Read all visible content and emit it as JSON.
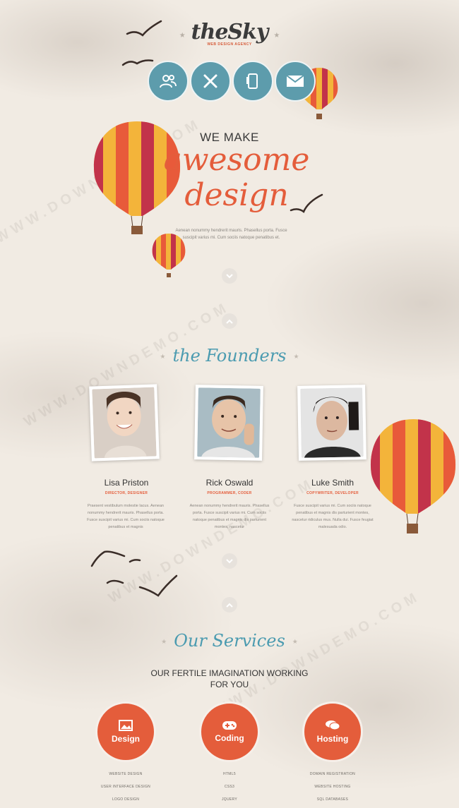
{
  "header": {
    "logo": "theSky",
    "tagline": "WEB DESIGN AGENCY",
    "nav": [
      {
        "icon": "users-icon"
      },
      {
        "icon": "tools-icon"
      },
      {
        "icon": "phone-icon"
      },
      {
        "icon": "mail-icon"
      }
    ]
  },
  "hero": {
    "kicker": "WE MAKE",
    "headline_line1": "awesome",
    "headline_line2": "design",
    "text": "Aenean nonummy hendrerit mauris. Phasellus porta. Fusce suscipit varius mi. Cum sociis natoque penatibus et."
  },
  "founders": {
    "title": "the Founders",
    "people": [
      {
        "name": "Lisa Priston",
        "role": "DIRECTOR, DESIGNER",
        "bio": "Praesent vestibulum molestie lacus. Aenean nonummy hendrerit mauris. Phasellus porta. Fusce suscipit varius mi. Cum sociis natoque penatibus et magnis"
      },
      {
        "name": "Rick Oswald",
        "role": "PROGRAMMER, CODER",
        "bio": "Aenean nonummy hendrerit mauris. Phasellus porta. Fusce suscipit varius mi. Cum sociis natoque penatibus et magnis dis parturient montes, nascetur"
      },
      {
        "name": "Luke Smith",
        "role": "COPYWRITER, DEVELOPER",
        "bio": "Fusce suscipit varius mi. Cum sociis natoque penatibus et magnis dis parturient montes, nascetur ridiculus mus. Nulla dui. Fusce feugiat malesuada odio."
      }
    ]
  },
  "services": {
    "title": "Our Services",
    "subtitle_line1": "OUR FERTILE IMAGINATION WORKING",
    "subtitle_line2": "FOR YOU",
    "items": [
      {
        "label": "Design",
        "icon": "image-icon",
        "list": [
          "WEBSITE DESIGN",
          "USER INTERFACE DESIGN",
          "LOGO DESIGN"
        ]
      },
      {
        "label": "Coding",
        "icon": "gamepad-icon",
        "list": [
          "HTML5",
          "CSS3",
          "JQUERY"
        ]
      },
      {
        "label": "Hosting",
        "icon": "chat-icon",
        "list": [
          "DOMAIN REGISTRATION",
          "WEBSITE HOSTING",
          "SQL DATABASES"
        ]
      }
    ]
  },
  "watermark": "WWW.DOWNDEMO.COM",
  "colors": {
    "accent": "#e45d3b",
    "teal": "#5d9cac",
    "background": "#f1ebe3"
  }
}
